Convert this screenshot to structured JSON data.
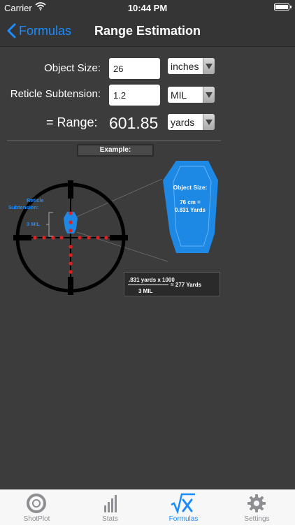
{
  "status_bar": {
    "carrier": "Carrier",
    "time": "10:44 PM"
  },
  "nav": {
    "back_label": "Formulas",
    "title": "Range Estimation"
  },
  "form": {
    "object_size": {
      "label": "Object Size:",
      "value": "26",
      "unit": "inches"
    },
    "reticle_subtension": {
      "label": "Reticle Subtension:",
      "value": "1.2",
      "unit": "MIL"
    },
    "range": {
      "label": "=  Range:",
      "value": "601.85",
      "unit": "yards"
    }
  },
  "example": {
    "badge": "Example:",
    "reticle_label_line1": "Reticle",
    "reticle_label_line2": "Subtension:",
    "mil_label": "3 MIL",
    "target_title": "Object Size:",
    "target_value_line1": "76 cm =",
    "target_value_line2": "0.831 Yards",
    "formula_numerator": ".831 yards x 1000",
    "formula_denominator": "3 MIL",
    "formula_result": "= 277 Yards"
  },
  "tabs": [
    {
      "label": "ShotPlot",
      "icon": "shotplot-icon",
      "active": false
    },
    {
      "label": "Stats",
      "icon": "stats-bars-icon",
      "active": false
    },
    {
      "label": "Formulas",
      "icon": "sqrt-x-icon",
      "active": true
    },
    {
      "label": "Settings",
      "icon": "gear-icon",
      "active": false
    }
  ],
  "colors": {
    "accent": "#1a8cff",
    "background": "#3c3c3c",
    "target_blue": "#1e88e5",
    "reticle_dot": "#e02020"
  }
}
